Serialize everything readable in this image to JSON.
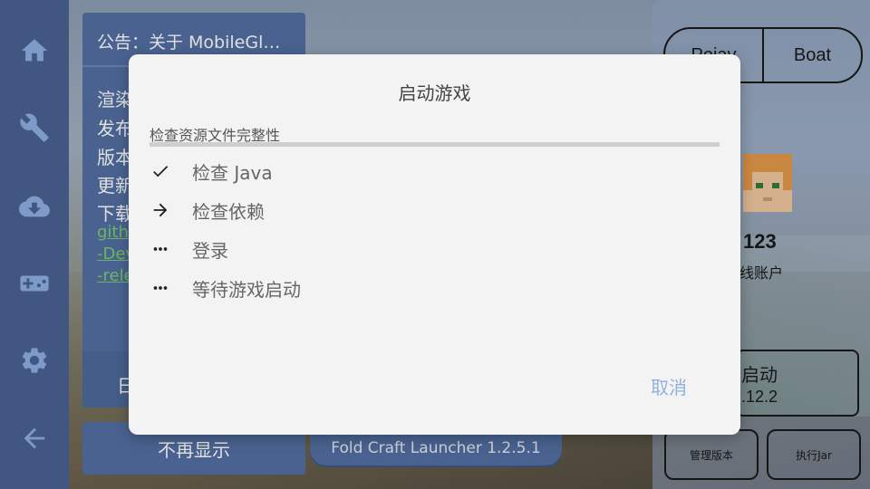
{
  "rail": {
    "items": [
      {
        "icon": "home-icon"
      },
      {
        "icon": "wrench-icon"
      },
      {
        "icon": "cloud-download-icon"
      },
      {
        "icon": "gamepad-icon"
      },
      {
        "icon": "gear-icon"
      },
      {
        "icon": "back-arrow-icon"
      }
    ]
  },
  "announcement": {
    "title": "公告：关于 MobileGl…",
    "lines": [
      "渲染",
      "发布",
      "版本",
      "更新",
      "下载"
    ],
    "links": [
      "gith",
      "-Dev",
      "-rele"
    ],
    "footer_label": "日"
  },
  "dismiss_label": "不再显示",
  "version_label": "Fold Craft Launcher 1.2.5.1",
  "account": {
    "tab_left": "Pojav",
    "tab_right": "Boat",
    "name": "123",
    "type": "线账户",
    "launch_label": "启动",
    "launch_version": ".12.2",
    "manage_label": "管理版本",
    "jar_label": "执行Jar"
  },
  "dialog": {
    "title": "启动游戏",
    "subtitle": "检查资源文件完整性",
    "progress": 0,
    "steps": [
      {
        "status": "done",
        "icon": "check-icon",
        "label": "检查 Java"
      },
      {
        "status": "active",
        "icon": "arrow-right-icon",
        "label": "检查依赖"
      },
      {
        "status": "pending",
        "icon": "more-horiz-icon",
        "label": "登录"
      },
      {
        "status": "pending",
        "icon": "more-horiz-icon",
        "label": "等待游戏启动"
      }
    ],
    "cancel_label": "取消"
  },
  "colors": {
    "rail": "#4a6393",
    "card": "#5470a3",
    "dialog_bg": "#f3f3f3",
    "cancel": "#8fb2dc",
    "link": "#7ad070"
  }
}
